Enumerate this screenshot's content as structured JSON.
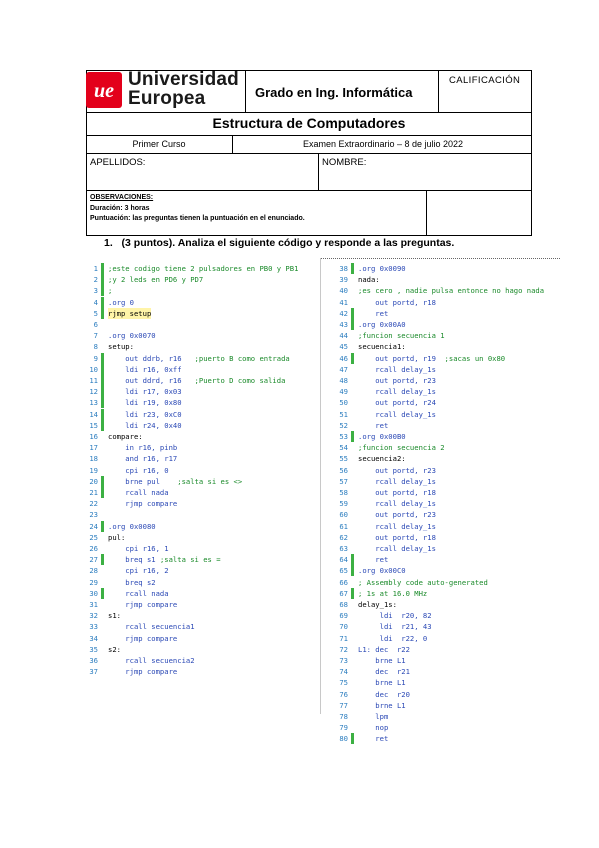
{
  "header": {
    "logo_line1": "Universidad",
    "logo_line2": "Europea",
    "degree": "Grado en Ing. Informática",
    "grade_label": "CALIFICACIÓN",
    "course_title": "Estructura de Computadores",
    "year": "Primer Curso",
    "exam": "Examen Extraordinario – 8 de julio 2022",
    "surname_label": "APELLIDOS:",
    "name_label": "NOMBRE:",
    "observations_label": "OBSERVACIONES:",
    "duration": "Duración: 3 horas",
    "scoring": "Puntuación: las preguntas tienen la puntuación en el enunciado."
  },
  "question": {
    "number": "1.",
    "text": "(3 puntos). Analiza el siguiente código y responde a las preguntas."
  },
  "colors": {
    "comment": "#1a8a2a",
    "keyword": "#2a48b5",
    "linenum": "#2b7dbf",
    "marker": "#3cb043",
    "label": "#000000"
  },
  "code_left": [
    {
      "n": "1",
      "t": ";este codigo tiene 2 pulsadores en PB0 y PB1",
      "k": "c",
      "m": true
    },
    {
      "n": "2",
      "t": ";y 2 leds en PD6 y PD7",
      "k": "c",
      "m": true
    },
    {
      "n": "3",
      "t": ";",
      "k": "c",
      "m": true
    },
    {
      "n": "4",
      "t": ".org 0",
      "k": "k",
      "m": true
    },
    {
      "n": "5",
      "t": "rjmp setup",
      "k": "h",
      "m": true
    },
    {
      "n": "6",
      "t": "",
      "k": "l",
      "m": false
    },
    {
      "n": "7",
      "t": ".org 0x0070",
      "k": "k",
      "m": false
    },
    {
      "n": "8",
      "t": "setup:",
      "k": "l",
      "m": false
    },
    {
      "n": "9",
      "t": "    out ddrb, r16   ;puerto B como entrada",
      "k": "k",
      "m": true
    },
    {
      "n": "10",
      "t": "    ldi r16, 0xff",
      "k": "k",
      "m": true
    },
    {
      "n": "11",
      "t": "    out ddrd, r16   ;Puerto D como salida",
      "k": "k",
      "m": true
    },
    {
      "n": "12",
      "t": "    ldi r17, 0x03",
      "k": "k",
      "m": true
    },
    {
      "n": "13",
      "t": "    ldi r19, 0x80",
      "k": "k",
      "m": true
    },
    {
      "n": "14",
      "t": "    ldi r23, 0xC0",
      "k": "k",
      "m": true
    },
    {
      "n": "15",
      "t": "    ldi r24, 0x40",
      "k": "k",
      "m": true
    },
    {
      "n": "16",
      "t": "compare:",
      "k": "l",
      "m": false
    },
    {
      "n": "17",
      "t": "    in r16, pinb",
      "k": "k",
      "m": false
    },
    {
      "n": "18",
      "t": "    and r16, r17",
      "k": "k",
      "m": false
    },
    {
      "n": "19",
      "t": "    cpi r16, 0",
      "k": "k",
      "m": false
    },
    {
      "n": "20",
      "t": "    brne pul    ;salta si es <>",
      "k": "k",
      "m": true
    },
    {
      "n": "21",
      "t": "    rcall nada",
      "k": "k",
      "m": true
    },
    {
      "n": "22",
      "t": "    rjmp compare",
      "k": "k",
      "m": false
    },
    {
      "n": "23",
      "t": "",
      "k": "l",
      "m": false
    },
    {
      "n": "24",
      "t": ".org 0x0080",
      "k": "k",
      "m": true
    },
    {
      "n": "25",
      "t": "pul:",
      "k": "l",
      "m": false
    },
    {
      "n": "26",
      "t": "    cpi r16, 1",
      "k": "k",
      "m": false
    },
    {
      "n": "27",
      "t": "    breq s1 ;salta si es =",
      "k": "k",
      "m": true
    },
    {
      "n": "28",
      "t": "    cpi r16, 2",
      "k": "k",
      "m": false
    },
    {
      "n": "29",
      "t": "    breq s2",
      "k": "k",
      "m": false
    },
    {
      "n": "30",
      "t": "    rcall nada",
      "k": "k",
      "m": true
    },
    {
      "n": "31",
      "t": "    rjmp compare",
      "k": "k",
      "m": false
    },
    {
      "n": "32",
      "t": "s1:",
      "k": "l",
      "m": false
    },
    {
      "n": "33",
      "t": "    rcall secuencia1",
      "k": "k",
      "m": false
    },
    {
      "n": "34",
      "t": "    rjmp compare",
      "k": "k",
      "m": false
    },
    {
      "n": "35",
      "t": "s2:",
      "k": "l",
      "m": false
    },
    {
      "n": "36",
      "t": "    rcall secuencia2",
      "k": "k",
      "m": false
    },
    {
      "n": "37",
      "t": "    rjmp compare",
      "k": "k",
      "m": false
    }
  ],
  "code_right": [
    {
      "n": "38",
      "t": ".org 0x0090",
      "k": "k",
      "m": true
    },
    {
      "n": "39",
      "t": "nada:",
      "k": "l",
      "m": false
    },
    {
      "n": "40",
      "t": ";es cero , nadie pulsa entonce no hago nada",
      "k": "c",
      "m": false
    },
    {
      "n": "41",
      "t": "    out portd, r18",
      "k": "k",
      "m": false
    },
    {
      "n": "42",
      "t": "    ret",
      "k": "k",
      "m": true
    },
    {
      "n": "43",
      "t": ".org 0x00A0",
      "k": "k",
      "m": true
    },
    {
      "n": "44",
      "t": ";funcion secuencia 1",
      "k": "c",
      "m": false
    },
    {
      "n": "45",
      "t": "secuencia1:",
      "k": "l",
      "m": false
    },
    {
      "n": "46",
      "t": "    out portd, r19  ;sacas un 0x80",
      "k": "k",
      "m": true
    },
    {
      "n": "47",
      "t": "    rcall delay_1s",
      "k": "k",
      "m": false
    },
    {
      "n": "48",
      "t": "    out portd, r23",
      "k": "k",
      "m": false
    },
    {
      "n": "49",
      "t": "    rcall delay_1s",
      "k": "k",
      "m": false
    },
    {
      "n": "50",
      "t": "    out portd, r24",
      "k": "k",
      "m": false
    },
    {
      "n": "51",
      "t": "    rcall delay_1s",
      "k": "k",
      "m": false
    },
    {
      "n": "52",
      "t": "    ret",
      "k": "k",
      "m": false
    },
    {
      "n": "53",
      "t": ".org 0x00B0",
      "k": "k",
      "m": true
    },
    {
      "n": "54",
      "t": ";funcion secuencia 2",
      "k": "c",
      "m": false
    },
    {
      "n": "55",
      "t": "secuencia2:",
      "k": "l",
      "m": false
    },
    {
      "n": "56",
      "t": "    out portd, r23",
      "k": "k",
      "m": false
    },
    {
      "n": "57",
      "t": "    rcall delay_1s",
      "k": "k",
      "m": false
    },
    {
      "n": "58",
      "t": "    out portd, r18",
      "k": "k",
      "m": false
    },
    {
      "n": "59",
      "t": "    rcall delay_1s",
      "k": "k",
      "m": false
    },
    {
      "n": "60",
      "t": "    out portd, r23",
      "k": "k",
      "m": false
    },
    {
      "n": "61",
      "t": "    rcall delay_1s",
      "k": "k",
      "m": false
    },
    {
      "n": "62",
      "t": "    out portd, r18",
      "k": "k",
      "m": false
    },
    {
      "n": "63",
      "t": "    rcall delay_1s",
      "k": "k",
      "m": false
    },
    {
      "n": "64",
      "t": "    ret",
      "k": "k",
      "m": true
    },
    {
      "n": "65",
      "t": ".org 0x00C0",
      "k": "k",
      "m": true
    },
    {
      "n": "66",
      "t": "; Assembly code auto-generated",
      "k": "c",
      "m": false
    },
    {
      "n": "67",
      "t": "; 1s at 16.0 MHz",
      "k": "c",
      "m": true
    },
    {
      "n": "68",
      "t": "delay_1s:",
      "k": "l",
      "m": false
    },
    {
      "n": "69",
      "t": "     ldi  r20, 82",
      "k": "k",
      "m": false
    },
    {
      "n": "70",
      "t": "     ldi  r21, 43",
      "k": "k",
      "m": false
    },
    {
      "n": "71",
      "t": "     ldi  r22, 0",
      "k": "k",
      "m": false
    },
    {
      "n": "72",
      "t": "L1: dec  r22",
      "k": "k",
      "m": false
    },
    {
      "n": "73",
      "t": "    brne L1",
      "k": "k",
      "m": false
    },
    {
      "n": "74",
      "t": "    dec  r21",
      "k": "k",
      "m": false
    },
    {
      "n": "75",
      "t": "    brne L1",
      "k": "k",
      "m": false
    },
    {
      "n": "76",
      "t": "    dec  r20",
      "k": "k",
      "m": false
    },
    {
      "n": "77",
      "t": "    brne L1",
      "k": "k",
      "m": false
    },
    {
      "n": "78",
      "t": "    lpm",
      "k": "k",
      "m": false
    },
    {
      "n": "79",
      "t": "    nop",
      "k": "k",
      "m": false
    },
    {
      "n": "80",
      "t": "    ret",
      "k": "k",
      "m": true
    }
  ]
}
